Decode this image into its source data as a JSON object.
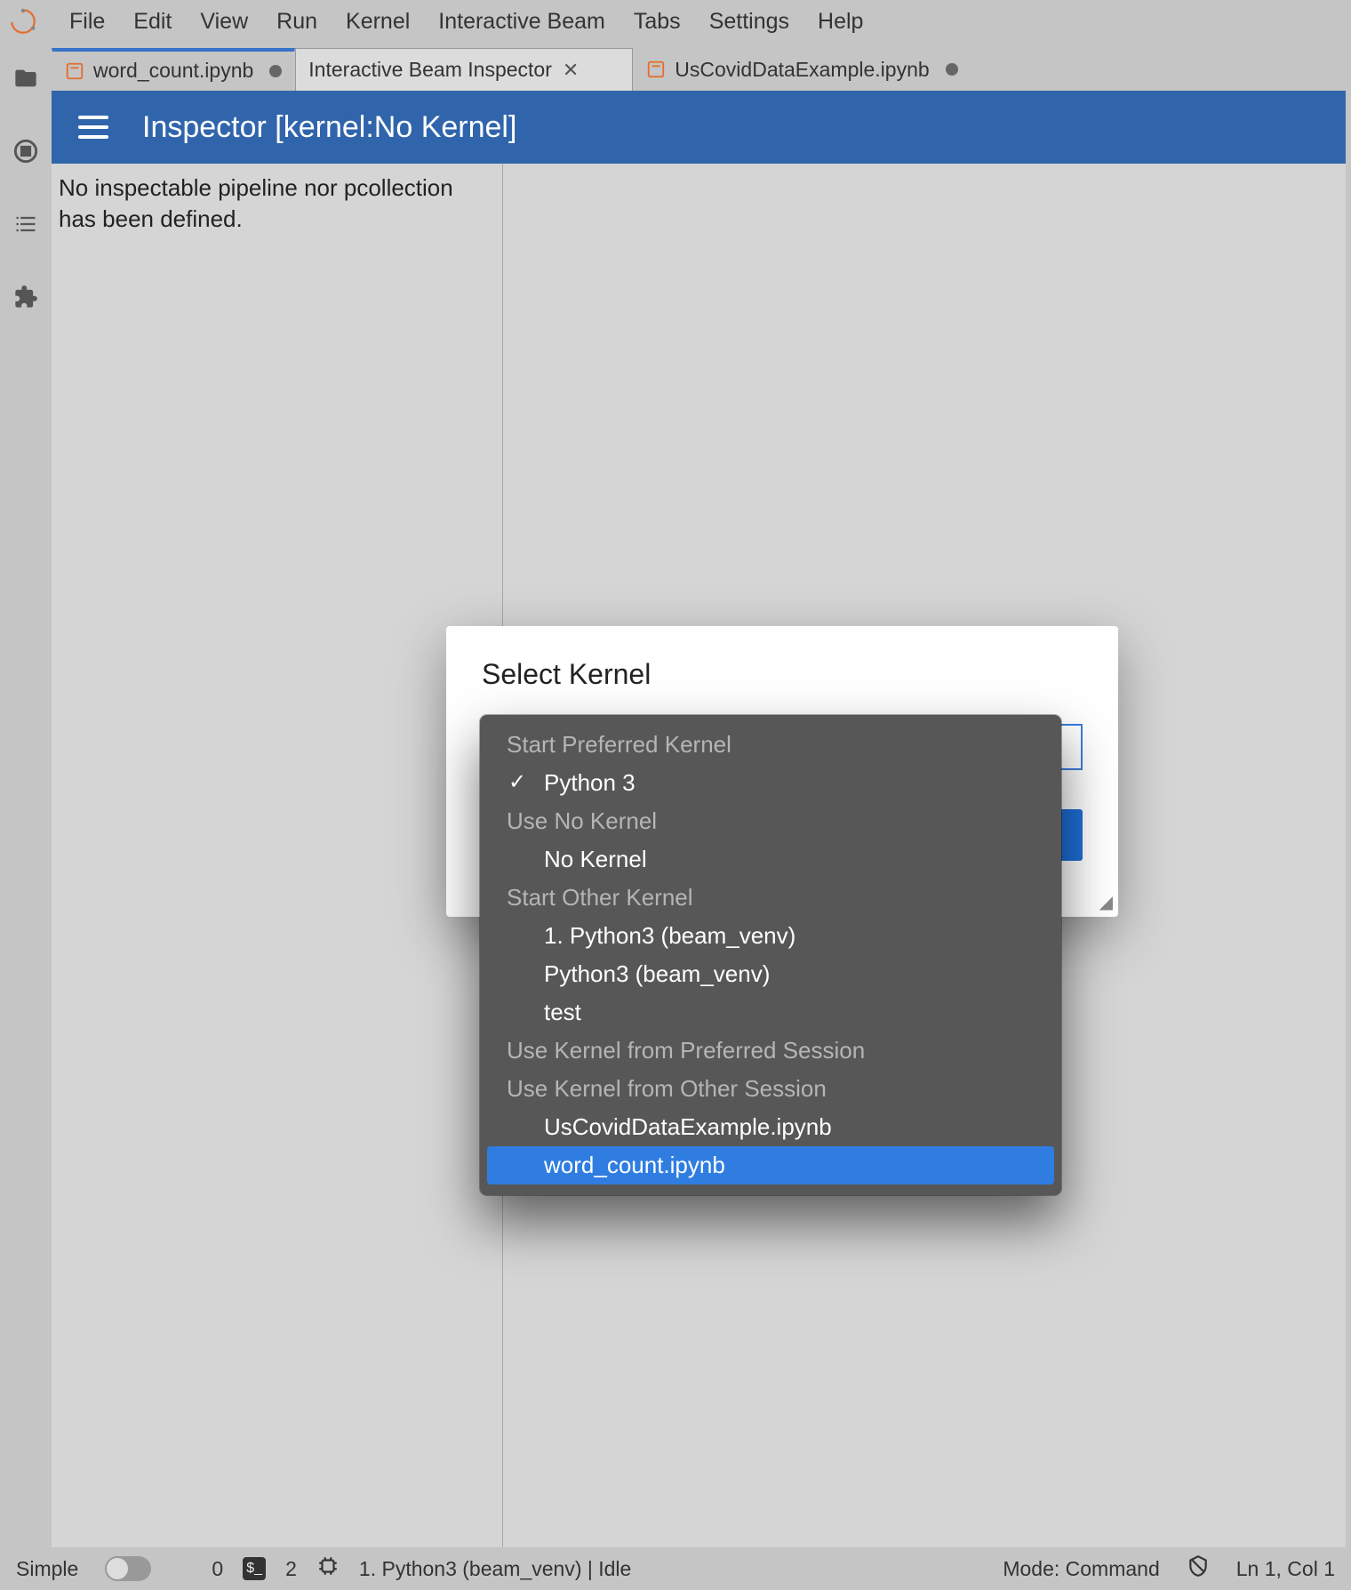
{
  "menubar": {
    "items": [
      "File",
      "Edit",
      "View",
      "Run",
      "Kernel",
      "Interactive Beam",
      "Tabs",
      "Settings",
      "Help"
    ]
  },
  "tabs": [
    {
      "label": "word_count.ipynb",
      "has_icon": true,
      "dirty": true,
      "closeable": false
    },
    {
      "label": "Interactive Beam Inspector",
      "has_icon": false,
      "dirty": false,
      "closeable": true
    },
    {
      "label": "UsCovidDataExample.ipynb",
      "has_icon": true,
      "dirty": true,
      "closeable": false
    }
  ],
  "inspector": {
    "title": "Inspector [kernel:No Kernel]",
    "empty_message": "No inspectable pipeline nor pcollection has been defined."
  },
  "modal": {
    "title": "Select Kernel"
  },
  "dropdown": {
    "section1": "Start Preferred Kernel",
    "section2": "Use No Kernel",
    "section3": "Start Other Kernel",
    "section4": "Use Kernel from Preferred Session",
    "section5": "Use Kernel from Other Session",
    "items": {
      "python3": "Python 3",
      "no_kernel": "No Kernel",
      "other1": "1. Python3 (beam_venv)",
      "other2": "Python3 (beam_venv)",
      "other3": "test",
      "sess1": "UsCovidDataExample.ipynb",
      "sess2": "word_count.ipynb"
    }
  },
  "statusbar": {
    "simple": "Simple",
    "count0": "0",
    "count2": "2",
    "kernel_status": "1. Python3 (beam_venv) | Idle",
    "mode": "Mode: Command",
    "position": "Ln 1, Col 1",
    "terminal_glyph": "$_"
  }
}
